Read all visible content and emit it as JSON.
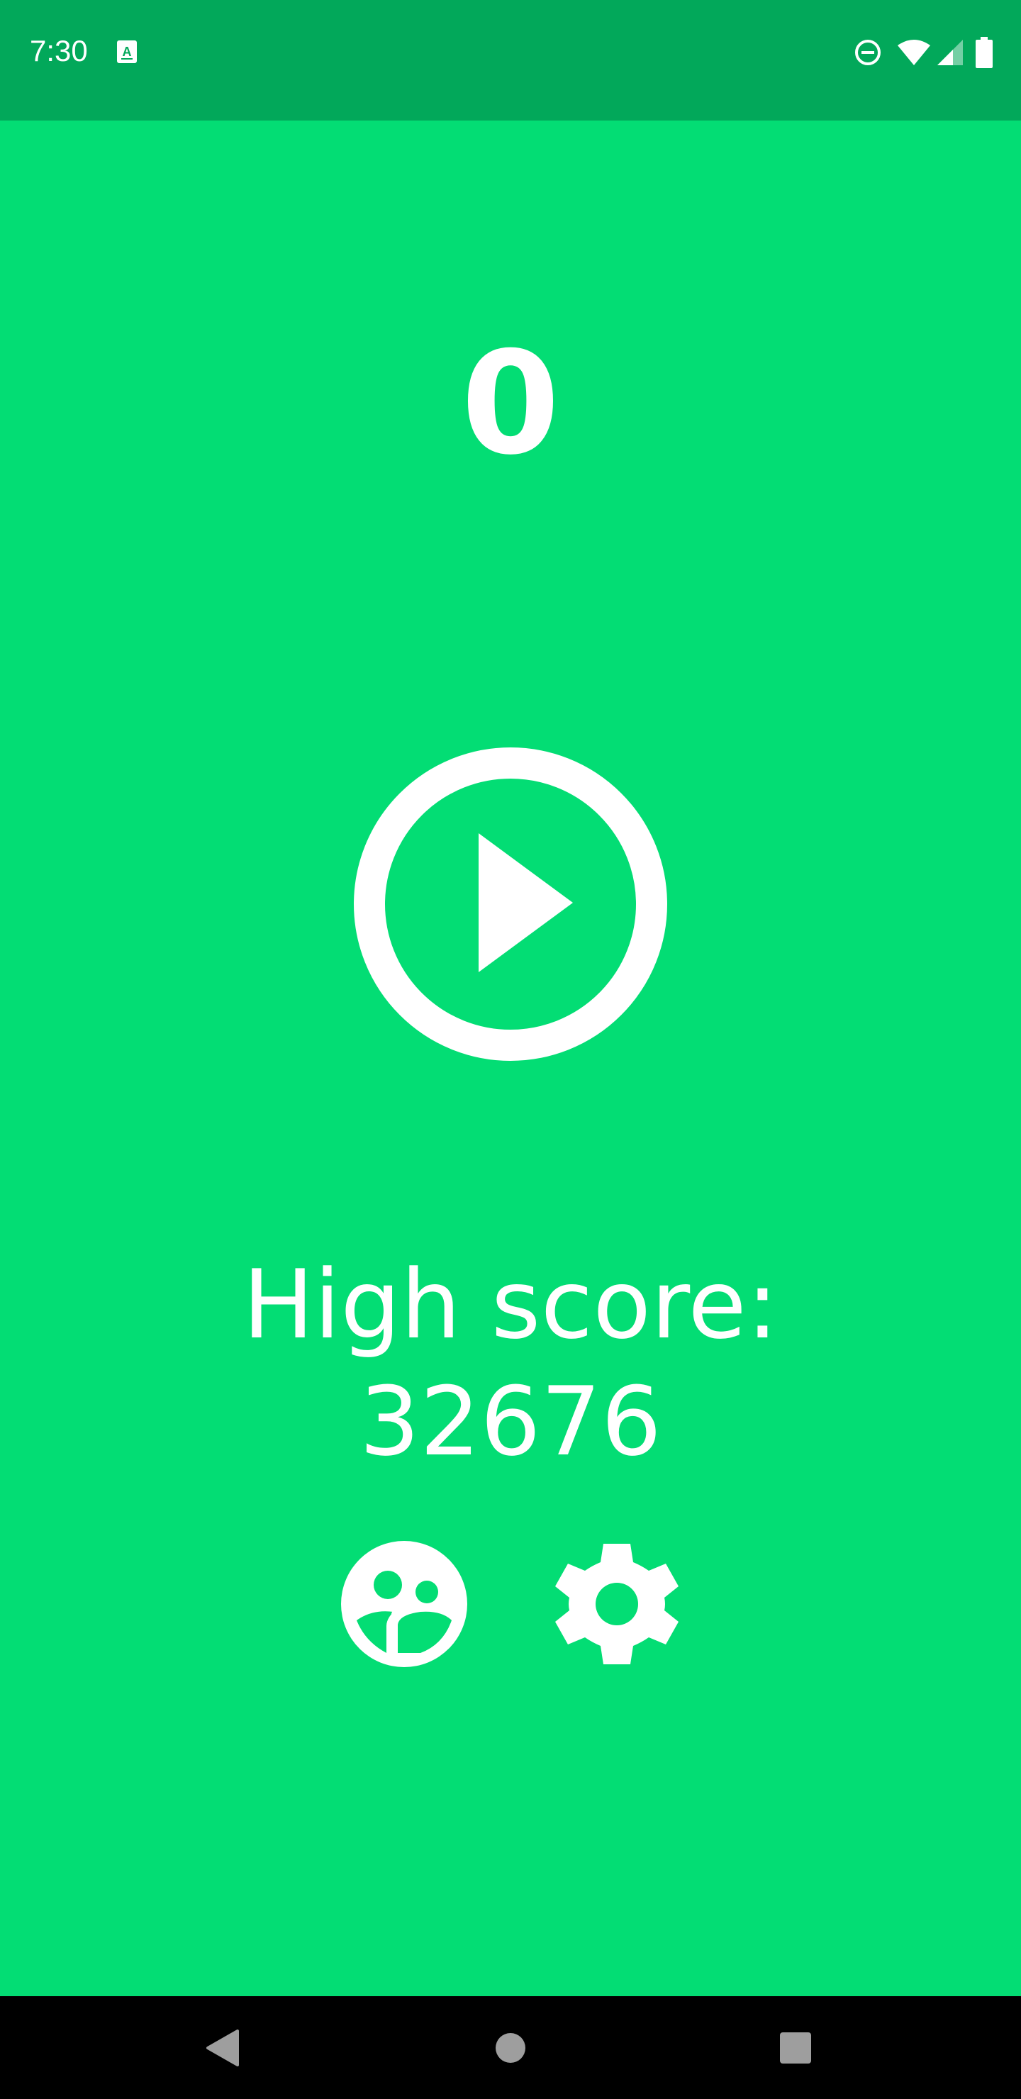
{
  "status_bar": {
    "time": "7:30",
    "left_icons": [
      "keyboard-a-icon"
    ],
    "right_icons": [
      "do-not-disturb-icon",
      "wifi-icon",
      "cell-signal-icon",
      "battery-icon"
    ]
  },
  "game": {
    "score": "0",
    "high_score_label": "High score:",
    "high_score_value": "32676",
    "buttons": {
      "play": "play-circle-icon",
      "leaderboard": "leaderboard-icon",
      "settings": "gear-icon"
    }
  },
  "nav_bar": {
    "buttons": [
      "back-icon",
      "home-icon",
      "recents-icon"
    ]
  },
  "colors": {
    "background": "#03DD74",
    "status_bar": "#02A85A",
    "foreground": "#FFFFFF",
    "nav_bar": "#000000"
  }
}
